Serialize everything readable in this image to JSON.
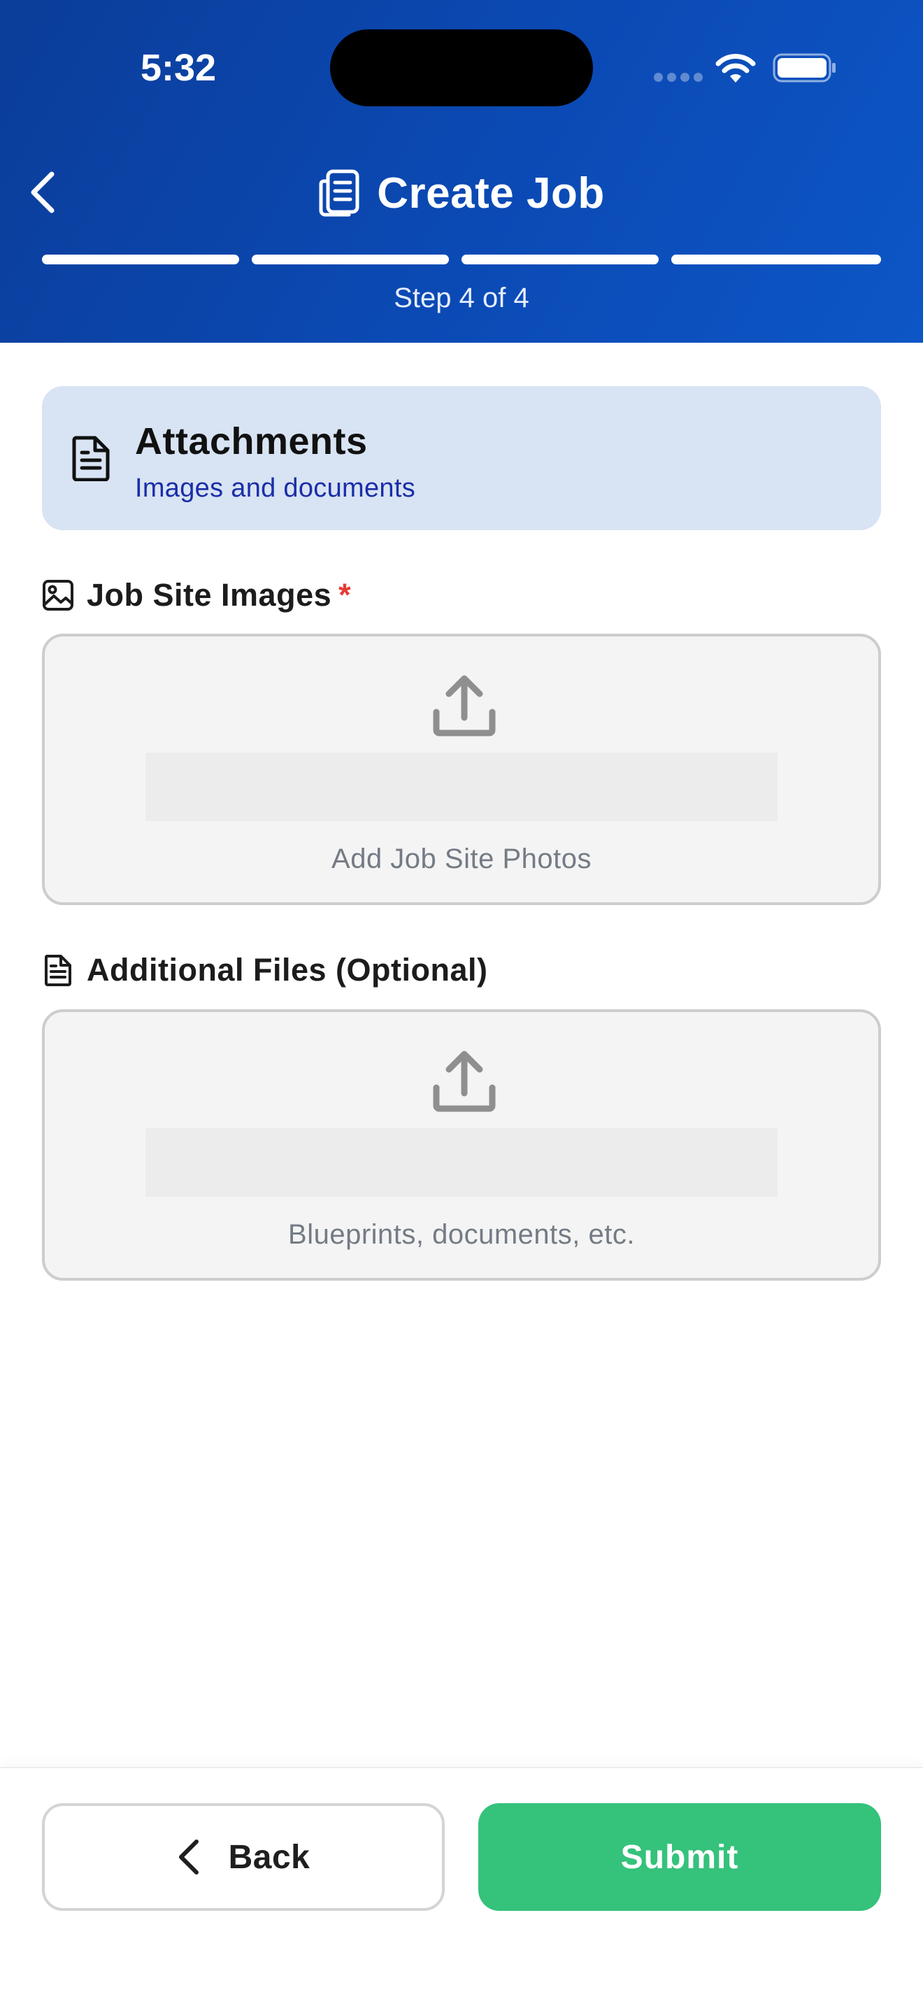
{
  "status_bar": {
    "time": "5:32"
  },
  "header": {
    "back_icon": "chevron-left-icon",
    "title_icon": "clipboard-document-icon",
    "title": "Create Job",
    "progress": {
      "current_step": 4,
      "total_steps": 4
    },
    "step_label": "Step 4 of 4"
  },
  "section": {
    "icon": "document-icon",
    "title": "Attachments",
    "subtitle": "Images and documents"
  },
  "job_site_images": {
    "icon": "image-icon",
    "label": "Job Site Images",
    "required_mark": "*",
    "upload_icon": "upload-icon",
    "prompt": "Add Job Site Photos"
  },
  "additional_files": {
    "icon": "document-icon",
    "label": "Additional Files (Optional)",
    "upload_icon": "upload-icon",
    "prompt": "Blueprints, documents, etc."
  },
  "footer": {
    "back_label": "Back",
    "submit_label": "Submit"
  },
  "colors": {
    "header_gradient_start": "#0b3d99",
    "header_gradient_end": "#0d56c6",
    "section_card_bg": "#d8e3f3",
    "section_subtitle": "#1a2ea8",
    "required": "#e53935",
    "submit_bg": "#35c27b"
  }
}
